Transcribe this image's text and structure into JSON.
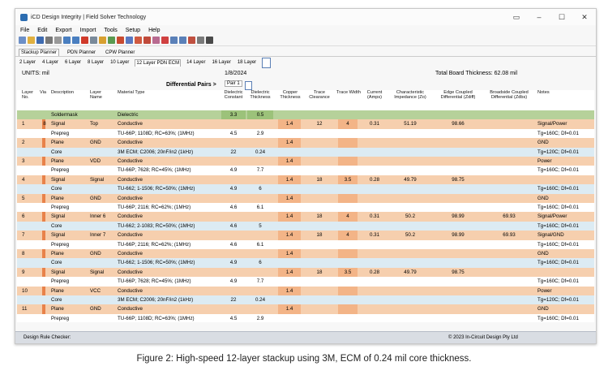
{
  "window": {
    "title": "iCD Design Integrity | Field Solver Technology"
  },
  "menu": [
    "File",
    "Edit",
    "Export",
    "Import",
    "Tools",
    "Setup",
    "Help"
  ],
  "planner_tabs": [
    "Stackup Planner",
    "PDN Planner",
    "CPW Planner"
  ],
  "layer_tabs": [
    "2 Layer",
    "4 Layer",
    "6 Layer",
    "8 Layer",
    "10 Layer",
    "12 Layer PDN ECM",
    "14 Layer",
    "16 Layer",
    "18 Layer"
  ],
  "info": {
    "units": "UNITS: mil",
    "date": "1/8/2024",
    "total_thickness": "Total Board Thickness: 62.08 mil",
    "diff_label": "Differential Pairs >",
    "pair_tab": "Pair 1"
  },
  "columns": {
    "layer": "Layer No.",
    "via": "Via",
    "desc": "Description",
    "name": "Layer Name",
    "material": "Material Type",
    "dk": "Dielectric Constant",
    "dthick": "Dielectric Thickness",
    "cu": "Copper Thickness",
    "clear": "Trace Clearance",
    "width": "Trace Width",
    "current": "Current (Amps)",
    "zo": "Characteristic Impedance (Zo)",
    "zdiff": "Edge Coupled Differential (Zdiff)",
    "zdbs": "Broadside Coupled Differential (Zdbs)",
    "notes": "Notes"
  },
  "rows": [
    {
      "type": "mask",
      "layer": "",
      "desc": "Soldermask",
      "name": "",
      "material": "Dielectric",
      "dk": "3.3",
      "dthick": "0.5",
      "cu": "",
      "clear": "",
      "width": "",
      "current": "",
      "zo": "",
      "zdiff": "",
      "zdbs": "",
      "notes": ""
    },
    {
      "type": "signal",
      "layer": "1",
      "via": "8",
      "desc": "Signal",
      "name": "Top",
      "material": "Conductive",
      "dk": "",
      "dthick": "",
      "cu": "1.4",
      "clear": "12",
      "width": "4",
      "current": "0.31",
      "zo": "51.19",
      "zdiff": "98.66",
      "zdbs": "",
      "notes": "Signal/Power"
    },
    {
      "type": "diel",
      "layer": "",
      "desc": "Prepreg",
      "name": "",
      "material": "TU-66P; 1108D; RC=63%; (1MHz)",
      "dk": "4.5",
      "dthick": "2.9",
      "cu": "",
      "clear": "",
      "width": "",
      "current": "",
      "zo": "",
      "zdiff": "",
      "zdbs": "",
      "notes": "Tg=160C; Df=0.01"
    },
    {
      "type": "plane",
      "layer": "2",
      "desc": "Plane",
      "name": "GND",
      "material": "Conductive",
      "dk": "",
      "dthick": "",
      "cu": "1.4",
      "clear": "",
      "width": "",
      "current": "",
      "zo": "",
      "zdiff": "",
      "zdbs": "",
      "notes": "GND"
    },
    {
      "type": "core",
      "layer": "",
      "desc": "Core",
      "name": "",
      "material": "3M ECM; C2006; 20nF/in2 (1kHz)",
      "dk": "22",
      "dthick": "0.24",
      "cu": "",
      "clear": "",
      "width": "",
      "current": "",
      "zo": "",
      "zdiff": "",
      "zdbs": "",
      "notes": "Tg=120C; Df=0.01"
    },
    {
      "type": "plane",
      "layer": "3",
      "desc": "Plane",
      "name": "VDD",
      "material": "Conductive",
      "dk": "",
      "dthick": "",
      "cu": "1.4",
      "clear": "",
      "width": "",
      "current": "",
      "zo": "",
      "zdiff": "",
      "zdbs": "",
      "notes": "Power"
    },
    {
      "type": "diel",
      "layer": "",
      "desc": "Prepreg",
      "name": "",
      "material": "TU-66P; 7628; RC=45%; (1MHz)",
      "dk": "4.9",
      "dthick": "7.7",
      "cu": "",
      "clear": "",
      "width": "",
      "current": "",
      "zo": "",
      "zdiff": "",
      "zdbs": "",
      "notes": "Tg=160C; Df=0.01"
    },
    {
      "type": "signal",
      "layer": "4",
      "desc": "Signal",
      "name": "Signal",
      "material": "Conductive",
      "dk": "",
      "dthick": "",
      "cu": "1.4",
      "clear": "18",
      "width": "3.5",
      "current": "0.28",
      "zo": "49.79",
      "zdiff": "98.75",
      "zdbs": "",
      "notes": ""
    },
    {
      "type": "core",
      "layer": "",
      "desc": "Core",
      "name": "",
      "material": "TU-662; 1-1506; RC=50%; (1MHz)",
      "dk": "4.9",
      "dthick": "6",
      "cu": "",
      "clear": "",
      "width": "",
      "current": "",
      "zo": "",
      "zdiff": "",
      "zdbs": "",
      "notes": "Tg=160C; Df=0.01"
    },
    {
      "type": "plane",
      "layer": "5",
      "desc": "Plane",
      "name": "GND",
      "material": "Conductive",
      "dk": "",
      "dthick": "",
      "cu": "1.4",
      "clear": "",
      "width": "",
      "current": "",
      "zo": "",
      "zdiff": "",
      "zdbs": "",
      "notes": "GND"
    },
    {
      "type": "diel",
      "layer": "",
      "desc": "Prepreg",
      "name": "",
      "material": "TU-66P; 2116; RC=62%; (1MHz)",
      "dk": "4.6",
      "dthick": "6.1",
      "cu": "",
      "clear": "",
      "width": "",
      "current": "",
      "zo": "",
      "zdiff": "",
      "zdbs": "",
      "notes": "Tg=160C; Df=0.01"
    },
    {
      "type": "signal",
      "layer": "6",
      "desc": "Signal",
      "name": "Inner 6",
      "material": "Conductive",
      "dk": "",
      "dthick": "",
      "cu": "1.4",
      "clear": "18",
      "width": "4",
      "current": "0.31",
      "zo": "50.2",
      "zdiff": "98.99",
      "zdbs": "69.93",
      "notes": "Signal/Power"
    },
    {
      "type": "core",
      "layer": "",
      "desc": "Core",
      "name": "",
      "material": "TU-662; 2-1083; RC=50%; (1MHz)",
      "dk": "4.6",
      "dthick": "5",
      "cu": "",
      "clear": "",
      "width": "",
      "current": "",
      "zo": "",
      "zdiff": "",
      "zdbs": "",
      "notes": "Tg=160C; Df=0.01"
    },
    {
      "type": "signal",
      "layer": "7",
      "desc": "Signal",
      "name": "Inner 7",
      "material": "Conductive",
      "dk": "",
      "dthick": "",
      "cu": "1.4",
      "clear": "18",
      "width": "4",
      "current": "0.31",
      "zo": "50.2",
      "zdiff": "98.99",
      "zdbs": "69.93",
      "notes": "Signal/GND"
    },
    {
      "type": "diel",
      "layer": "",
      "desc": "Prepreg",
      "name": "",
      "material": "TU-66P; 2116; RC=62%; (1MHz)",
      "dk": "4.6",
      "dthick": "6.1",
      "cu": "",
      "clear": "",
      "width": "",
      "current": "",
      "zo": "",
      "zdiff": "",
      "zdbs": "",
      "notes": "Tg=160C; Df=0.01"
    },
    {
      "type": "plane",
      "layer": "8",
      "desc": "Plane",
      "name": "GND",
      "material": "Conductive",
      "dk": "",
      "dthick": "",
      "cu": "1.4",
      "clear": "",
      "width": "",
      "current": "",
      "zo": "",
      "zdiff": "",
      "zdbs": "",
      "notes": "GND"
    },
    {
      "type": "core",
      "layer": "",
      "desc": "Core",
      "name": "",
      "material": "TU-662; 1-1506; RC=50%; (1MHz)",
      "dk": "4.9",
      "dthick": "6",
      "cu": "",
      "clear": "",
      "width": "",
      "current": "",
      "zo": "",
      "zdiff": "",
      "zdbs": "",
      "notes": "Tg=160C; Df=0.01"
    },
    {
      "type": "signal",
      "layer": "9",
      "desc": "Signal",
      "name": "Signal",
      "material": "Conductive",
      "dk": "",
      "dthick": "",
      "cu": "1.4",
      "clear": "18",
      "width": "3.5",
      "current": "0.28",
      "zo": "49.79",
      "zdiff": "98.75",
      "zdbs": "",
      "notes": ""
    },
    {
      "type": "diel",
      "layer": "",
      "desc": "Prepreg",
      "name": "",
      "material": "TU-66P; 7628; RC=45%; (1MHz)",
      "dk": "4.9",
      "dthick": "7.7",
      "cu": "",
      "clear": "",
      "width": "",
      "current": "",
      "zo": "",
      "zdiff": "",
      "zdbs": "",
      "notes": "Tg=160C; Df=0.01"
    },
    {
      "type": "plane",
      "layer": "10",
      "desc": "Plane",
      "name": "VCC",
      "material": "Conductive",
      "dk": "",
      "dthick": "",
      "cu": "1.4",
      "clear": "",
      "width": "",
      "current": "",
      "zo": "",
      "zdiff": "",
      "zdbs": "",
      "notes": "Power"
    },
    {
      "type": "core",
      "layer": "",
      "desc": "Core",
      "name": "",
      "material": "3M ECM; C2006; 20nF/in2 (1kHz)",
      "dk": "22",
      "dthick": "0.24",
      "cu": "",
      "clear": "",
      "width": "",
      "current": "",
      "zo": "",
      "zdiff": "",
      "zdbs": "",
      "notes": "Tg=120C; Df=0.01"
    },
    {
      "type": "plane",
      "layer": "11",
      "desc": "Plane",
      "name": "GND",
      "material": "Conductive",
      "dk": "",
      "dthick": "",
      "cu": "1.4",
      "clear": "",
      "width": "",
      "current": "",
      "zo": "",
      "zdiff": "",
      "zdbs": "",
      "notes": "GND"
    },
    {
      "type": "diel",
      "layer": "",
      "desc": "Prepreg",
      "name": "",
      "material": "TU-66P; 1108D; RC=63%; (1MHz)",
      "dk": "4.5",
      "dthick": "2.9",
      "cu": "",
      "clear": "",
      "width": "",
      "current": "",
      "zo": "",
      "zdiff": "",
      "zdbs": "",
      "notes": "Tg=160C; Df=0.01"
    },
    {
      "type": "signal",
      "layer": "12",
      "desc": "Signal",
      "name": "Bottom",
      "material": "Conductive",
      "dk": "",
      "dthick": "",
      "cu": "1.4",
      "clear": "12",
      "width": "4",
      "current": "0.31",
      "zo": "51.19",
      "zdiff": "98.66",
      "zdbs": "",
      "notes": "Signal/Power"
    }
  ],
  "status": {
    "left": "Design Rule Checker:",
    "right": "© 2023 In-Circuit Design Pty Ltd"
  },
  "caption": "Figure 2: High-speed 12-layer stackup using 3M, ECM of 0.24 mil core thickness.",
  "colors": {
    "signal": "#f6cfae",
    "plane": "#f6cfae",
    "core": "#dcebf3",
    "diel": "#ffffff",
    "mask": "#b6d19a",
    "cu_cell": "#f3b487",
    "via": "#e8824a"
  }
}
